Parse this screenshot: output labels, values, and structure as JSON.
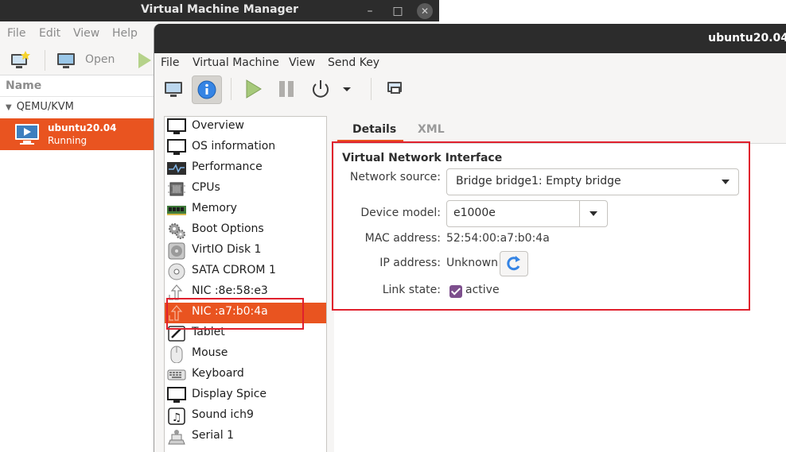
{
  "manager_window": {
    "title": "Virtual Machine Manager",
    "minimize_glyph": "–",
    "maximize_glyph": "□",
    "close_glyph": "✕",
    "menu": [
      "File",
      "Edit",
      "View",
      "Help"
    ],
    "toolbar": {
      "open_label": "Open"
    },
    "list_header": "Name",
    "group": "QEMU/KVM",
    "vm": {
      "name": "ubuntu20.04",
      "state": "Running"
    }
  },
  "vm_window": {
    "title": "ubuntu20.04",
    "menu": [
      "File",
      "Virtual Machine",
      "View",
      "Send Key"
    ],
    "tabs": {
      "details": "Details",
      "xml": "XML"
    },
    "devices": [
      {
        "label": "Overview",
        "icon": "monitor-icon"
      },
      {
        "label": "OS information",
        "icon": "monitor-icon"
      },
      {
        "label": "Performance",
        "icon": "performance-icon"
      },
      {
        "label": "CPUs",
        "icon": "cpu-icon"
      },
      {
        "label": "Memory",
        "icon": "memory-icon"
      },
      {
        "label": "Boot Options",
        "icon": "gears-icon"
      },
      {
        "label": "VirtIO Disk 1",
        "icon": "disk-icon"
      },
      {
        "label": "SATA CDROM 1",
        "icon": "cdrom-icon"
      },
      {
        "label": "NIC :8e:58:e3",
        "icon": "network-icon"
      },
      {
        "label": "NIC :a7:b0:4a",
        "icon": "network-icon"
      },
      {
        "label": "Tablet",
        "icon": "tablet-icon"
      },
      {
        "label": "Mouse",
        "icon": "mouse-icon"
      },
      {
        "label": "Keyboard",
        "icon": "keyboard-icon"
      },
      {
        "label": "Display Spice",
        "icon": "monitor-icon"
      },
      {
        "label": "Sound ich9",
        "icon": "sound-icon"
      },
      {
        "label": "Serial 1",
        "icon": "serial-icon"
      }
    ],
    "selected_device_index": 9,
    "nic": {
      "section_title": "Virtual Network Interface",
      "network_source_label": "Network source:",
      "network_source_value": "Bridge bridge1: Empty bridge",
      "device_model_label": "Device model:",
      "device_model_value": "e1000e",
      "mac_label": "MAC address:",
      "mac_value": "52:54:00:a7:b0:4a",
      "ip_label": "IP address:",
      "ip_value": "Unknown",
      "link_state_label": "Link state:",
      "link_state_value": "active",
      "link_active": true
    }
  },
  "colors": {
    "accent": "#e95420",
    "highlight_box": "#e0202d",
    "checkbox": "#7d4f8d",
    "titlebar": "#2c2c2c"
  }
}
